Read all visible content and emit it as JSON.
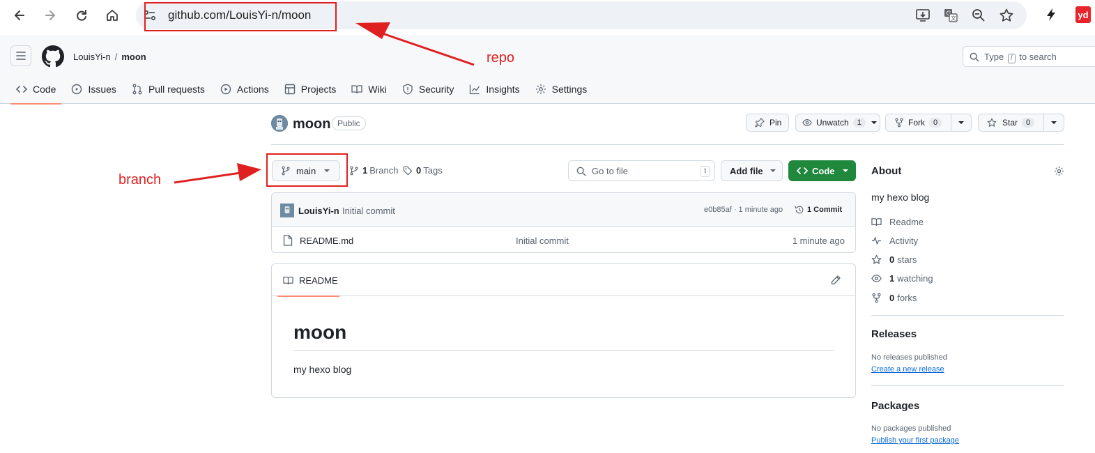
{
  "browser": {
    "url": "github.com/LouisYi-n/moon",
    "ext_badge": "yd"
  },
  "header": {
    "owner": "LouisYi-n",
    "separator": "/",
    "repo": "moon",
    "search_prefix": "Type",
    "search_key": "/",
    "search_suffix": "to search"
  },
  "tabs": [
    {
      "label": "Code",
      "icon": "code-icon"
    },
    {
      "label": "Issues",
      "icon": "issue-icon"
    },
    {
      "label": "Pull requests",
      "icon": "pull-request-icon"
    },
    {
      "label": "Actions",
      "icon": "play-icon"
    },
    {
      "label": "Projects",
      "icon": "table-icon"
    },
    {
      "label": "Wiki",
      "icon": "book-icon"
    },
    {
      "label": "Security",
      "icon": "shield-icon"
    },
    {
      "label": "Insights",
      "icon": "graph-icon"
    },
    {
      "label": "Settings",
      "icon": "gear-icon"
    }
  ],
  "repo": {
    "name": "moon",
    "visibility": "Public",
    "pin_label": "Pin",
    "unwatch_label": "Unwatch",
    "watch_count": "1",
    "fork_label": "Fork",
    "fork_count": "0",
    "star_label": "Star",
    "star_count": "0"
  },
  "toolbar": {
    "branch": "main",
    "branch_count": "1",
    "branch_label": "Branch",
    "tag_count": "0",
    "tag_label": "Tags",
    "goto_placeholder": "Go to file",
    "goto_key": "t",
    "add_file": "Add file",
    "code_button": "Code"
  },
  "commit": {
    "author": "LouisYi-n",
    "message": "Initial commit",
    "meta": "e0b85af · 1 minute ago",
    "count": "1 Commit"
  },
  "files": [
    {
      "name": "README.md",
      "commit": "Initial commit",
      "time": "1 minute ago"
    }
  ],
  "readme": {
    "tab": "README",
    "heading": "moon",
    "body": "my hexo blog"
  },
  "sidebar": {
    "about_title": "About",
    "description": "my hexo blog",
    "items": [
      {
        "count": "",
        "label": "Readme",
        "icon": "book-icon"
      },
      {
        "count": "",
        "label": "Activity",
        "icon": "pulse-icon"
      },
      {
        "count": "0",
        "label": "stars",
        "icon": "star-icon"
      },
      {
        "count": "1",
        "label": "watching",
        "icon": "eye-icon"
      },
      {
        "count": "0",
        "label": "forks",
        "icon": "fork-icon"
      }
    ],
    "releases_title": "Releases",
    "releases_note": "No releases published",
    "releases_link": "Create a new release",
    "packages_title": "Packages",
    "packages_note": "No packages published",
    "packages_link": "Publish your first package"
  },
  "annotations": {
    "repo_label": "repo",
    "branch_label": "branch",
    "color": "#e02020"
  },
  "colors": {
    "accent_tab": "#fd8c73",
    "code_button": "#1f883d",
    "link": "#0969da"
  }
}
